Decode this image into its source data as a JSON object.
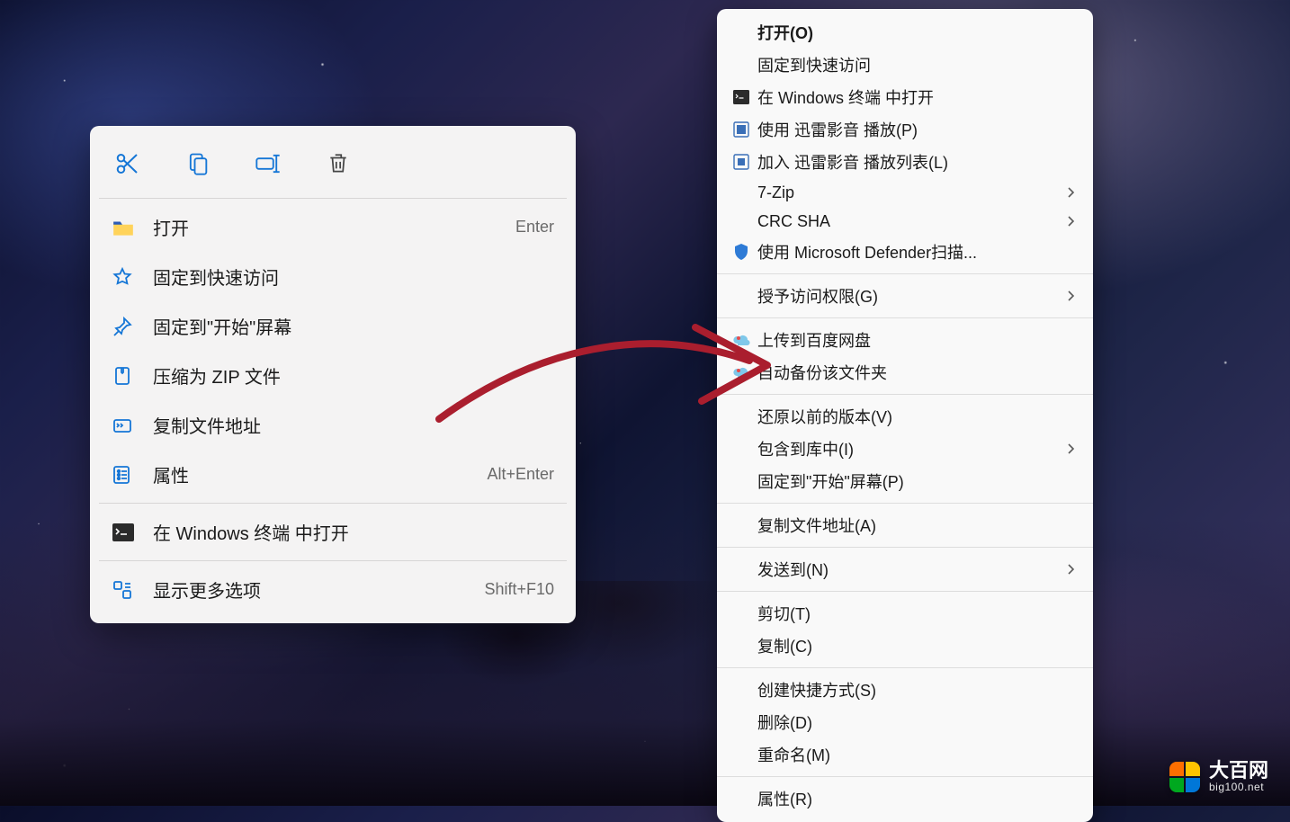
{
  "background": {
    "type": "space-nebula-desktop-wallpaper"
  },
  "annotation_arrow": {
    "color": "#aa1e2e",
    "from": "win11-context-menu-area",
    "to": "classic-context-menu-midsection"
  },
  "win11_menu": {
    "toolbar_icons": [
      "cut",
      "copy",
      "rename",
      "delete"
    ],
    "items": [
      {
        "icon": "folder-icon",
        "label": "打开",
        "hint": "Enter"
      },
      {
        "icon": "star-icon",
        "label": "固定到快速访问",
        "hint": ""
      },
      {
        "icon": "pin-icon",
        "label": "固定到\"开始\"屏幕",
        "hint": ""
      },
      {
        "icon": "zip-icon",
        "label": "压缩为 ZIP 文件",
        "hint": ""
      },
      {
        "icon": "path-icon",
        "label": "复制文件地址",
        "hint": ""
      },
      {
        "icon": "properties-icon",
        "label": "属性",
        "hint": "Alt+Enter"
      }
    ],
    "sep_then": [
      {
        "icon": "terminal-icon",
        "label": "在 Windows 终端 中打开",
        "hint": ""
      }
    ],
    "sep_then2": [
      {
        "icon": "more-icon",
        "label": "显示更多选项",
        "hint": "Shift+F10"
      }
    ]
  },
  "classic_menu": {
    "groups": [
      [
        {
          "icon": "",
          "label": "打开(O)",
          "bold": true,
          "submenu": false
        },
        {
          "icon": "",
          "label": "固定到快速访问",
          "submenu": false
        },
        {
          "icon": "terminal-small-icon",
          "label": "在 Windows 终端 中打开",
          "submenu": false
        },
        {
          "icon": "xunlei-play-icon",
          "label": "使用 迅雷影音 播放(P)",
          "submenu": false
        },
        {
          "icon": "xunlei-playlist-icon",
          "label": "加入 迅雷影音 播放列表(L)",
          "submenu": false
        },
        {
          "icon": "",
          "label": "7-Zip",
          "submenu": true
        },
        {
          "icon": "",
          "label": "CRC SHA",
          "submenu": true
        },
        {
          "icon": "defender-shield-icon",
          "label": "使用 Microsoft Defender扫描...",
          "submenu": false
        }
      ],
      [
        {
          "icon": "",
          "label": "授予访问权限(G)",
          "submenu": true
        }
      ],
      [
        {
          "icon": "baidu-cloud-icon",
          "label": "上传到百度网盘",
          "submenu": false
        },
        {
          "icon": "baidu-cloud-icon",
          "label": "自动备份该文件夹",
          "submenu": false
        }
      ],
      [
        {
          "icon": "",
          "label": "还原以前的版本(V)",
          "submenu": false
        },
        {
          "icon": "",
          "label": "包含到库中(I)",
          "submenu": true
        },
        {
          "icon": "",
          "label": "固定到\"开始\"屏幕(P)",
          "submenu": false
        }
      ],
      [
        {
          "icon": "",
          "label": "复制文件地址(A)",
          "submenu": false
        }
      ],
      [
        {
          "icon": "",
          "label": "发送到(N)",
          "submenu": true
        }
      ],
      [
        {
          "icon": "",
          "label": "剪切(T)",
          "submenu": false
        },
        {
          "icon": "",
          "label": "复制(C)",
          "submenu": false
        }
      ],
      [
        {
          "icon": "",
          "label": "创建快捷方式(S)",
          "submenu": false
        },
        {
          "icon": "",
          "label": "删除(D)",
          "submenu": false
        },
        {
          "icon": "",
          "label": "重命名(M)",
          "submenu": false
        }
      ],
      [
        {
          "icon": "",
          "label": "属性(R)",
          "submenu": false
        }
      ]
    ]
  },
  "watermark": {
    "title": "大百网",
    "subtitle": "big100.net"
  }
}
